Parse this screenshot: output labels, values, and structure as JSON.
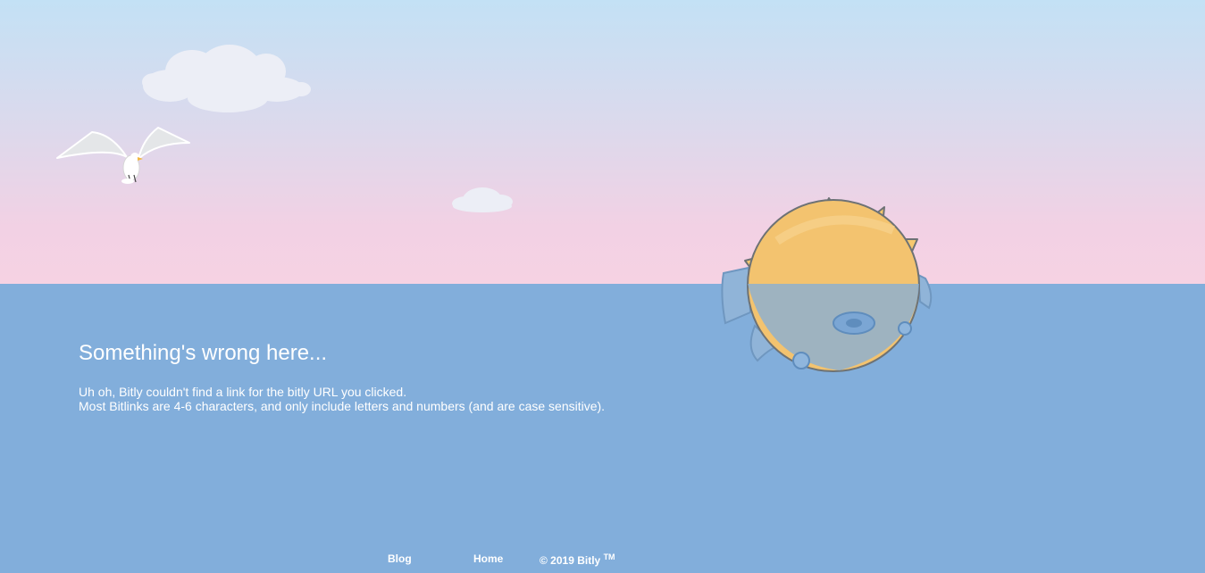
{
  "page": {
    "heading": "Something's wrong here...",
    "line1": "Uh oh, Bitly couldn't find a link for the bitly URL you clicked.",
    "line2": "Most Bitlinks are 4-6 characters, and only include letters and numbers (and are case sensitive)."
  },
  "footer": {
    "blog": "Blog",
    "home": "Home",
    "copyright": "© 2019 Bitly",
    "tm": "TM"
  },
  "colors": {
    "sky_top": "#c3e1f5",
    "sky_bottom": "#f6d2e3",
    "sea": "#82aedb",
    "pufferfish": "#f3c36f",
    "text": "#ffffff"
  },
  "icons": [
    "cloud-icon",
    "seagull-icon",
    "pufferfish-icon"
  ]
}
